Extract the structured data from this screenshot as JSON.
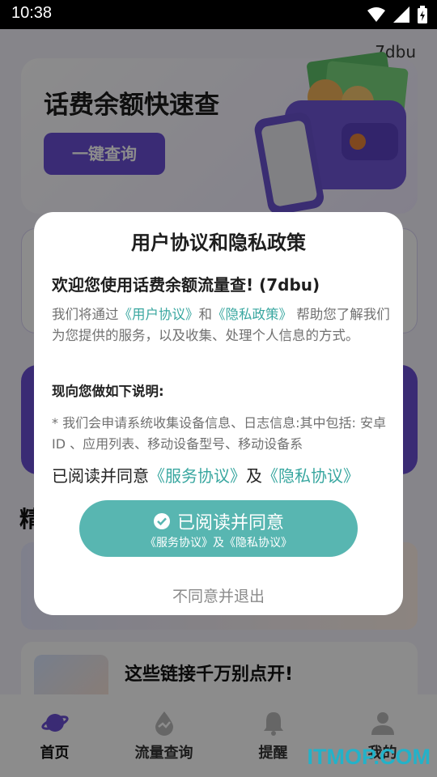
{
  "status_bar": {
    "time": "10:38"
  },
  "watermark_top": "7dbu",
  "hero": {
    "title": "话费余额快速查",
    "button": "一键查询"
  },
  "sections": {
    "featured_title": "精",
    "article_title": "这些链接千万别点开!"
  },
  "bottom_nav": [
    {
      "label": "首页",
      "icon": "planet-icon"
    },
    {
      "label": "流量查询",
      "icon": "flow-icon"
    },
    {
      "label": "提醒",
      "icon": "bell-icon"
    },
    {
      "label": "我的",
      "icon": "user-icon"
    }
  ],
  "dialog": {
    "title": "用户协议和隐私政策",
    "welcome": "欢迎您使用话费余额流量查! (7dbu)",
    "intro_pre": "我们将通过",
    "intro_link1": "《用户协议》",
    "intro_mid": "和",
    "intro_link2": "《隐私政策》",
    "intro_post": " 帮助您了解我们为您提供的服务，以及收集、处理个人信息的方式。",
    "notice_heading": "现向您做如下说明:",
    "notice_body": "* 我们会申请系统收集设备信息、日志信息:其中包括: 安卓ID 、应用列表、移动设备型号、移动设备系",
    "consent_pre": "已阅读并同意",
    "consent_link1": "《服务协议》",
    "consent_mid": "及",
    "consent_link2": "《隐私协议》",
    "agree_main": "已阅读并同意",
    "agree_sub": "《服务协议》及《隐私协议》",
    "decline": "不同意并退出"
  },
  "corner_watermark": "ITMOP.COM"
}
